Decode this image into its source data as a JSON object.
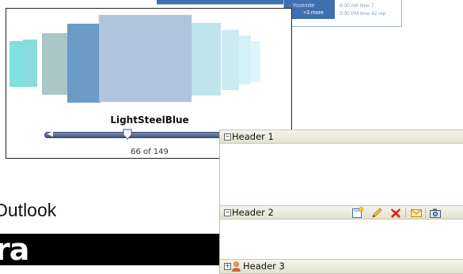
{
  "calendar": {
    "event1": "- Yosemite",
    "more": "+3 more",
    "right_line1": "8:00 AM time 7",
    "right_line2": "3:00 PM time 42 rep"
  },
  "coverflow": {
    "selected_label": "LightSteelBlue",
    "position_text": "66 of 149",
    "position_value": 66,
    "total": 149,
    "cards": [
      {
        "name": "card-left-4",
        "color": "#7fe0e0"
      },
      {
        "name": "card-left-3",
        "color": "#88dcdc"
      },
      {
        "name": "card-left-2",
        "color": "#a9c6c8"
      },
      {
        "name": "card-left-1",
        "color": "#6b9bc6"
      },
      {
        "name": "card-center",
        "color": "#b0c4de"
      },
      {
        "name": "card-right-1",
        "color": "#bfe4ec"
      },
      {
        "name": "card-right-2",
        "color": "#cceaf2"
      },
      {
        "name": "card-right-3",
        "color": "#d4f1f9"
      },
      {
        "name": "card-right-4",
        "color": "#dff6fc"
      }
    ]
  },
  "accordion": {
    "headers": [
      {
        "title": "Header 1",
        "toggle": "⊟",
        "expanded": true
      },
      {
        "title": "Header 2",
        "toggle": "⊟",
        "expanded": true
      },
      {
        "title": "Header 3",
        "toggle": "⊞",
        "expanded": false
      }
    ],
    "toolbar_icons": [
      "new-note-icon",
      "edit-pencil-icon",
      "delete-x-icon",
      "mail-icon",
      "camera-icon"
    ]
  },
  "outlook_text": "Outlook",
  "logo_text": "ra"
}
